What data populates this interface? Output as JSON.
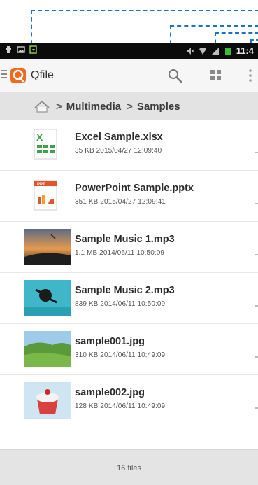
{
  "status_bar": {
    "time": "11:4"
  },
  "app": {
    "title": "Qfile"
  },
  "breadcrumb": {
    "items": [
      "Multimedia",
      "Samples"
    ]
  },
  "files": [
    {
      "name": "Excel Sample.xlsx",
      "meta": "35 KB  2015/04/27 12:09:40",
      "icon": "excel-icon"
    },
    {
      "name": "PowerPoint Sample.pptx",
      "meta": "351 KB  2015/04/27 12:09:41",
      "icon": "powerpoint-icon"
    },
    {
      "name": "Sample Music 1.mp3",
      "meta": "1.1 MB  2014/06/11 10:50:09",
      "icon": "music-thumbnail"
    },
    {
      "name": "Sample Music 2.mp3",
      "meta": "839 KB  2014/06/11 10:50:09",
      "icon": "music-thumbnail"
    },
    {
      "name": "sample001.jpg",
      "meta": "310 KB  2014/06/11 10:49:09",
      "icon": "image-thumbnail"
    },
    {
      "name": "sample002.jpg",
      "meta": "128 KB  2014/06/11 10:49:09",
      "icon": "image-thumbnail"
    }
  ],
  "footer": {
    "count": "16 files"
  },
  "colors": {
    "accent": "#f06a1e",
    "callout": "#1a73c9",
    "excel": "#3fa14c",
    "powerpoint": "#e2552b"
  }
}
